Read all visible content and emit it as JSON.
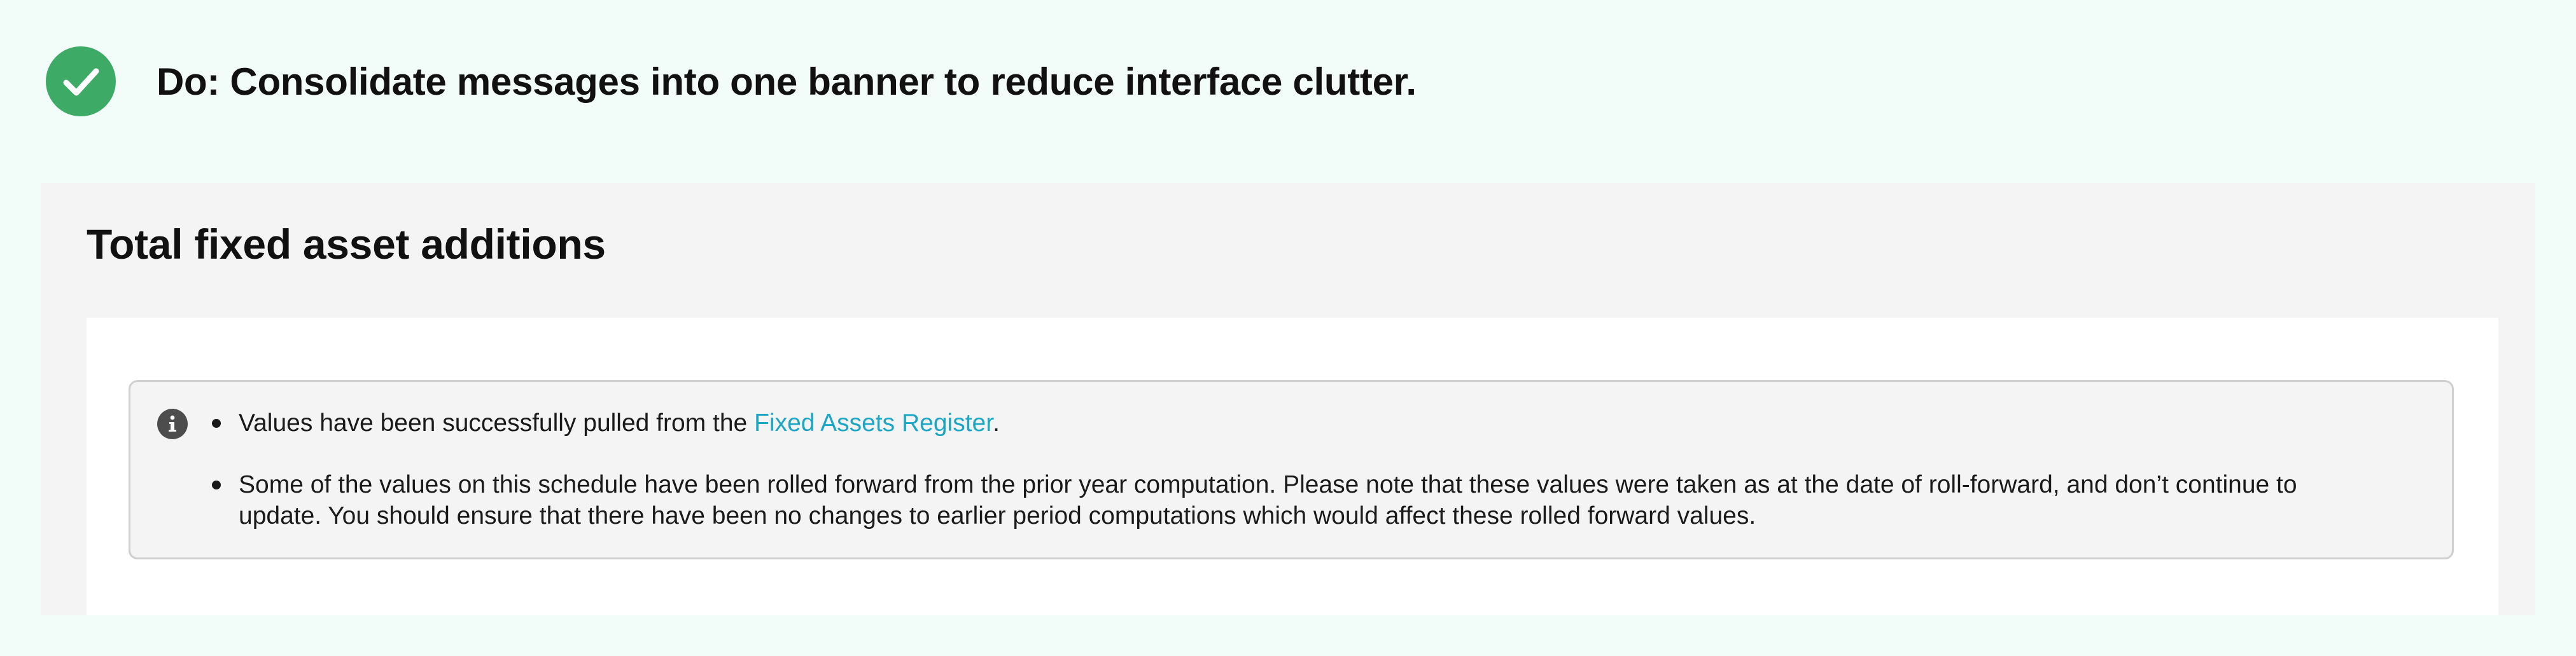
{
  "guideline": {
    "icon": "check-circle-icon",
    "text": "Do: Consolidate messages into one banner to reduce interface clutter.",
    "color": "#3daa66"
  },
  "panel": {
    "title": "Total fixed asset additions"
  },
  "banner": {
    "icon": "info-icon",
    "message1": {
      "before": "Values have been successfully pulled from the ",
      "link": "Fixed Assets Register",
      "after": "."
    },
    "message2": "Some of the values on this schedule have been rolled forward from the prior year computation. Please note that these values were taken as at the date of roll-forward, and don’t continue to update. You should ensure that there have been no changes to earlier period computations which would affect these rolled forward values.",
    "link_color": "#1ba6c4"
  }
}
